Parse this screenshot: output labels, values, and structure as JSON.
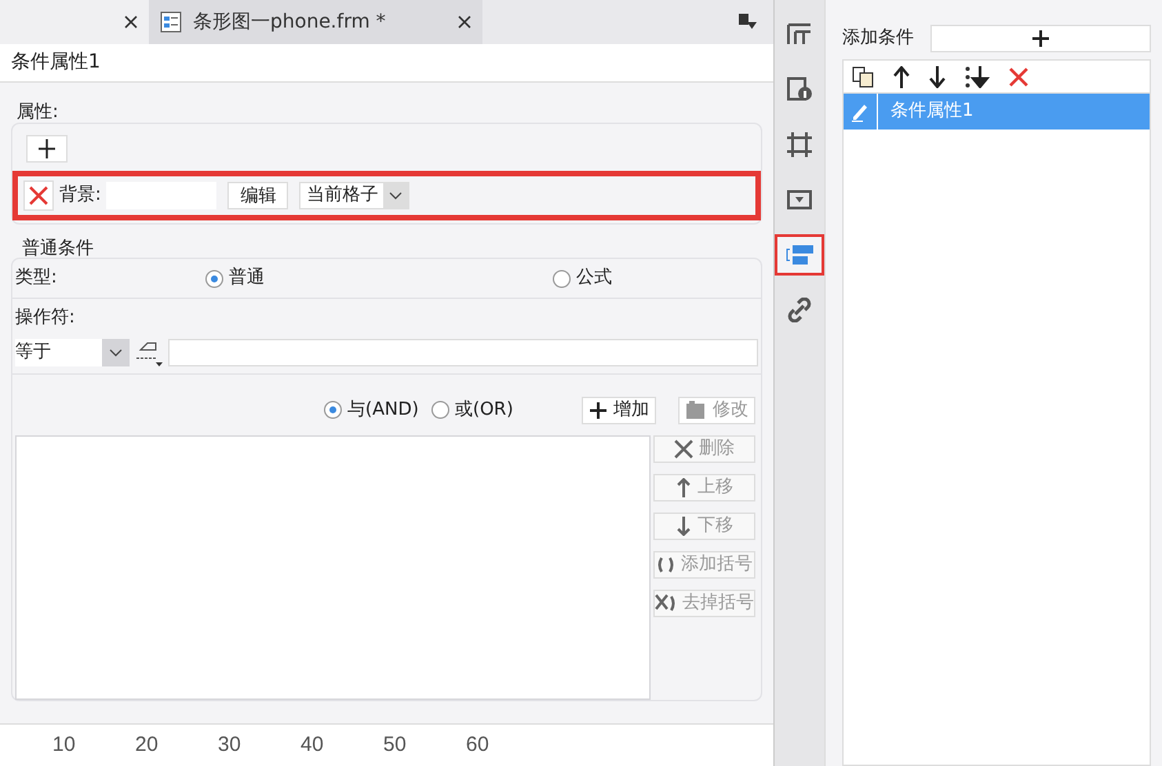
{
  "tabs": [
    {
      "selected": false
    },
    {
      "label": "条形图一phone.frm *",
      "selected": true
    }
  ],
  "dialog_title": "条件属性1",
  "properties": {
    "legend": "属性:",
    "background": {
      "label": "背景:",
      "edit_button": "编辑",
      "scope": "当前格子",
      "highlighted": true
    }
  },
  "general": {
    "legend": "普通条件",
    "type_label": "类型:",
    "types": [
      {
        "label": "普通",
        "selected": true
      },
      {
        "label": "公式",
        "selected": false
      }
    ],
    "operator_label": "操作符:",
    "operator": "等于",
    "joins": [
      {
        "label": "与(AND)",
        "selected": true
      },
      {
        "label": "或(OR)",
        "selected": false
      }
    ],
    "buttons": [
      {
        "kind": "plus",
        "label": "增加",
        "disabled": false
      },
      {
        "kind": "edit",
        "label": "修改",
        "disabled": true
      }
    ],
    "side_buttons": [
      {
        "kind": "delete",
        "label": "删除",
        "disabled": true
      },
      {
        "kind": "up",
        "label": "上移",
        "disabled": true
      },
      {
        "kind": "down",
        "label": "下移",
        "disabled": true
      },
      {
        "kind": "paren",
        "label": "添加括号",
        "disabled": true
      },
      {
        "kind": "unparen",
        "label": "去掉括号",
        "disabled": true
      }
    ]
  },
  "ruler": [
    "10",
    "20",
    "30",
    "40",
    "50",
    "60"
  ],
  "side_toolbar": [
    {
      "kind": "layout",
      "selected": false,
      "highlighted": false
    },
    {
      "kind": "info",
      "selected": false,
      "highlighted": false
    },
    {
      "kind": "frame",
      "selected": false,
      "highlighted": false
    },
    {
      "kind": "dropdown",
      "selected": false,
      "highlighted": false
    },
    {
      "kind": "condition",
      "selected": true,
      "highlighted": true
    },
    {
      "kind": "link",
      "selected": false,
      "highlighted": false
    }
  ],
  "right_panel": {
    "add_label": "添加条件",
    "conditions": [
      {
        "label": "条件属性1",
        "selected": true
      }
    ]
  }
}
